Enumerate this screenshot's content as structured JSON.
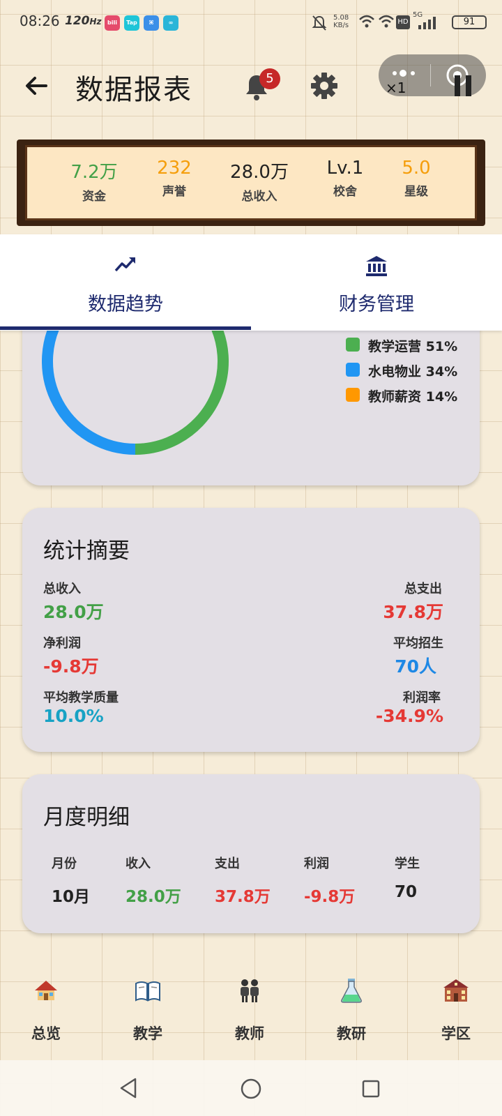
{
  "status_bar": {
    "time": "08:26",
    "refresh_rate": "120",
    "refresh_unit": "Hz",
    "net_speed": "5.08",
    "net_unit": "KB/s",
    "network": "5G",
    "hd": "HD",
    "battery": "91"
  },
  "header": {
    "title": "数据报表",
    "notification_count": "5",
    "speed": "×1"
  },
  "resources": [
    {
      "value": "7.2万",
      "label": "资金",
      "color": "#43a047"
    },
    {
      "value": "232",
      "label": "声誉",
      "color": "#f59e0b"
    },
    {
      "value": "28.0万",
      "label": "总收入",
      "color": "#222222"
    },
    {
      "value": "Lv.1",
      "label": "校舍",
      "color": "#222222"
    },
    {
      "value": "5.0",
      "label": "星级",
      "color": "#f59e0b"
    }
  ],
  "tabs": [
    {
      "label": "数据趋势",
      "icon": "trending-up-icon",
      "active": true
    },
    {
      "label": "财务管理",
      "icon": "bank-icon",
      "active": false
    }
  ],
  "chart_data": {
    "type": "pie",
    "style": "donut",
    "categories": [
      "教学运营",
      "水电物业",
      "教师薪资"
    ],
    "values": [
      51,
      34,
      14
    ],
    "unit": "%",
    "colors": [
      "#4caf50",
      "#2196f3",
      "#ff9800"
    ],
    "legend_position": "right"
  },
  "legend": [
    {
      "label": "教学运营",
      "pct": "51%"
    },
    {
      "label": "水电物业",
      "pct": "34%"
    },
    {
      "label": "教师薪资",
      "pct": "14%"
    }
  ],
  "summary": {
    "title": "统计摘要",
    "total_income_label": "总收入",
    "total_income_value": "28.0万",
    "total_expense_label": "总支出",
    "total_expense_value": "37.8万",
    "net_profit_label": "净利润",
    "net_profit_value": "-9.8万",
    "avg_enrollment_label": "平均招生",
    "avg_enrollment_value": "70人",
    "avg_quality_label": "平均教学质量",
    "avg_quality_value": "10.0%",
    "profit_rate_label": "利润率",
    "profit_rate_value": "-34.9%"
  },
  "monthly": {
    "title": "月度明细",
    "headers": [
      "月份",
      "收入",
      "支出",
      "利润",
      "学生"
    ],
    "rows": [
      [
        "10月",
        "28.0万",
        "37.8万",
        "-9.8万",
        "70"
      ]
    ]
  },
  "bottom_nav": [
    {
      "label": "总览",
      "icon": "house-icon"
    },
    {
      "label": "教学",
      "icon": "book-icon"
    },
    {
      "label": "教师",
      "icon": "teachers-icon"
    },
    {
      "label": "教研",
      "icon": "flask-icon"
    },
    {
      "label": "学区",
      "icon": "school-icon"
    }
  ]
}
